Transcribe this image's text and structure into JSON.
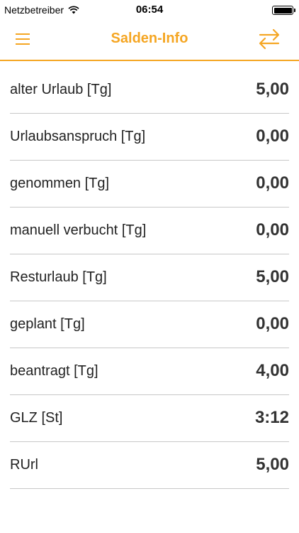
{
  "status": {
    "carrier": "Netzbetreiber",
    "time": "06:54",
    "wifi_icon": "wifi-icon",
    "battery_icon": "battery-icon"
  },
  "nav": {
    "title": "Salden-Info",
    "menu_icon": "hamburger-menu-icon",
    "swap_icon": "swap-arrows-icon",
    "accent_color": "#f5a623"
  },
  "rows": [
    {
      "label": "alter Urlaub [Tg]",
      "value": "5,00"
    },
    {
      "label": "Urlaubsanspruch [Tg]",
      "value": "0,00"
    },
    {
      "label": "genommen [Tg]",
      "value": "0,00"
    },
    {
      "label": "manuell verbucht [Tg]",
      "value": "0,00"
    },
    {
      "label": "Resturlaub [Tg]",
      "value": "5,00"
    },
    {
      "label": "geplant [Tg]",
      "value": "0,00"
    },
    {
      "label": "beantragt [Tg]",
      "value": "4,00"
    },
    {
      "label": "GLZ [St]",
      "value": "3:12"
    },
    {
      "label": "RUrl",
      "value": "5,00"
    }
  ]
}
